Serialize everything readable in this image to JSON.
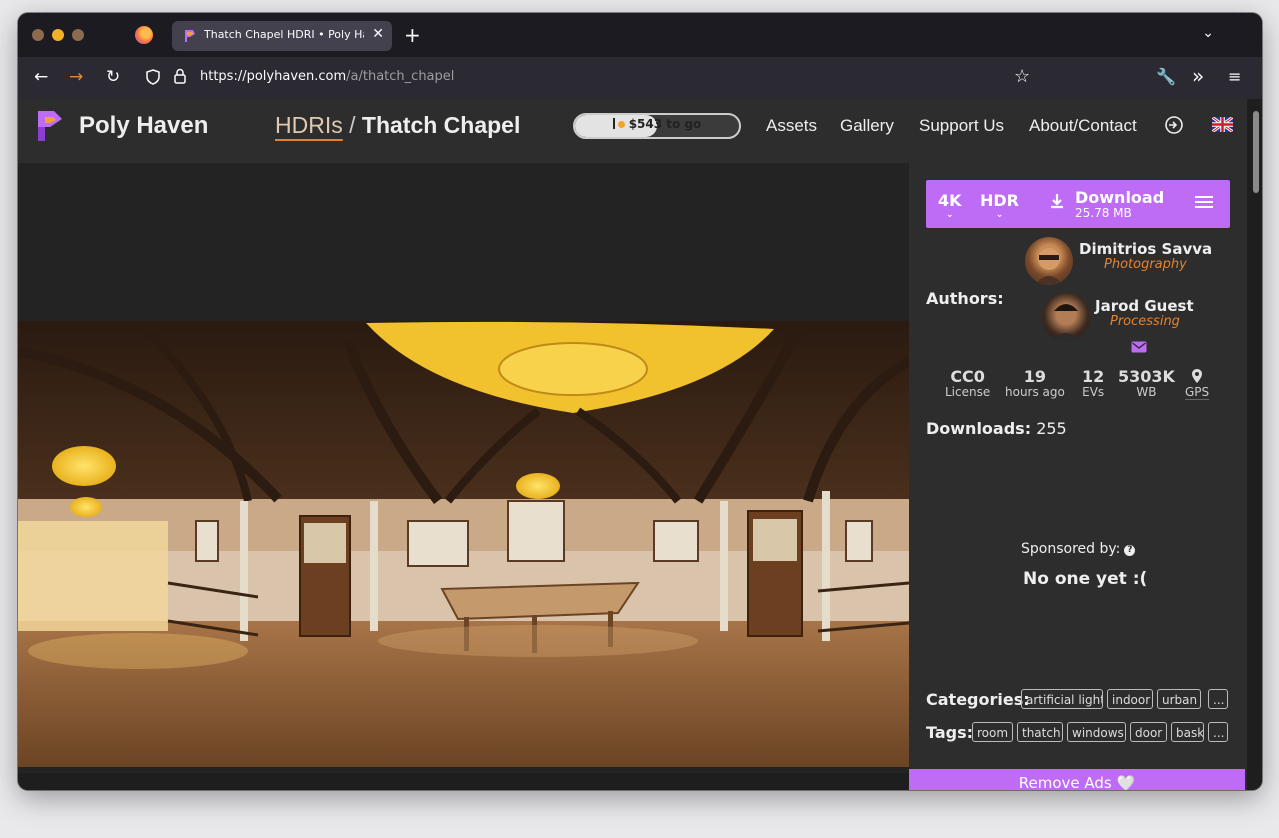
{
  "browser": {
    "tab_title": "Thatch Chapel HDRI • Poly Haven",
    "tab_close": "✕",
    "new_tab": "+",
    "url_host": "https://polyhaven.com",
    "url_path": "/a/thatch_chapel"
  },
  "site": {
    "brand": "Poly Haven",
    "breadcrumb": {
      "parent": "HDRIs",
      "separator": "/",
      "current": "Thatch Chapel"
    },
    "goal": {
      "label": "$543 to go",
      "progress": 0.5
    },
    "nav": [
      "Assets",
      "Gallery",
      "Support Us",
      "About/Contact"
    ]
  },
  "download": {
    "resolution": "4K",
    "format": "HDR",
    "label": "Download",
    "size": "25.78 MB"
  },
  "authors": {
    "label": "Authors:",
    "list": [
      {
        "name": "Dimitrios Savva",
        "role": "Photography"
      },
      {
        "name": "Jarod Guest",
        "role": "Processing"
      }
    ]
  },
  "stats": [
    {
      "value": "CC0",
      "label": "License"
    },
    {
      "value": "19",
      "label": "hours ago"
    },
    {
      "value": "12",
      "label": "EVs"
    },
    {
      "value": "5303K",
      "label": "WB"
    },
    {
      "value": "",
      "label": "GPS"
    }
  ],
  "downloads": {
    "label": "Downloads:",
    "count": "255"
  },
  "sponsor": {
    "label": "Sponsored by:",
    "help": "?",
    "none": "No one yet :("
  },
  "categories": {
    "label": "Categories:",
    "items": [
      "artificial light",
      "indoor",
      "urban",
      "..."
    ]
  },
  "tags": {
    "label": "Tags:",
    "items": [
      "room",
      "thatch",
      "windows",
      "door",
      "basket",
      "..."
    ]
  },
  "remove_ads": {
    "label": "Remove Ads",
    "heart": "🤍"
  },
  "colors": {
    "accent": "#be6cf5",
    "orange": "#e5822d",
    "background": "#1e1e1e",
    "panel": "#2d2d2d"
  }
}
